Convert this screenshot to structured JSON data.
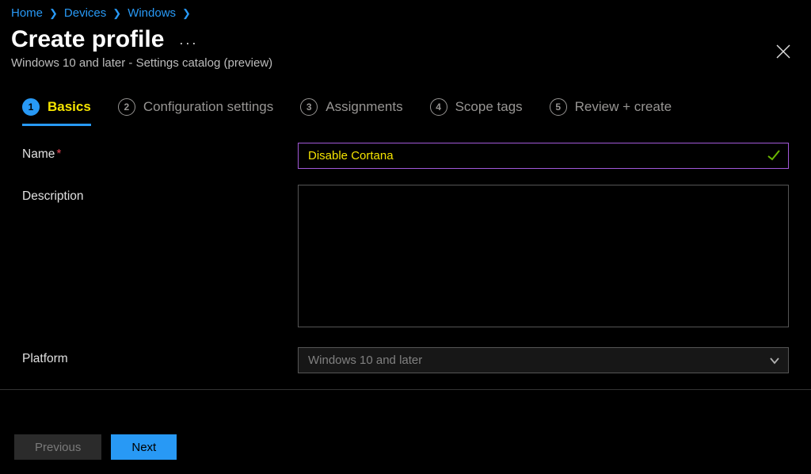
{
  "breadcrumb": {
    "home": "Home",
    "devices": "Devices",
    "windows": "Windows"
  },
  "header": {
    "title": "Create profile",
    "subtitle": "Windows 10 and later - Settings catalog (preview)"
  },
  "tabs": {
    "t1": {
      "num": "1",
      "label": "Basics"
    },
    "t2": {
      "num": "2",
      "label": "Configuration settings"
    },
    "t3": {
      "num": "3",
      "label": "Assignments"
    },
    "t4": {
      "num": "4",
      "label": "Scope tags"
    },
    "t5": {
      "num": "5",
      "label": "Review + create"
    }
  },
  "form": {
    "name_label": "Name",
    "name_value": "Disable Cortana",
    "desc_label": "Description",
    "desc_value": "",
    "platform_label": "Platform",
    "platform_value": "Windows 10 and later"
  },
  "footer": {
    "prev": "Previous",
    "next": "Next"
  }
}
